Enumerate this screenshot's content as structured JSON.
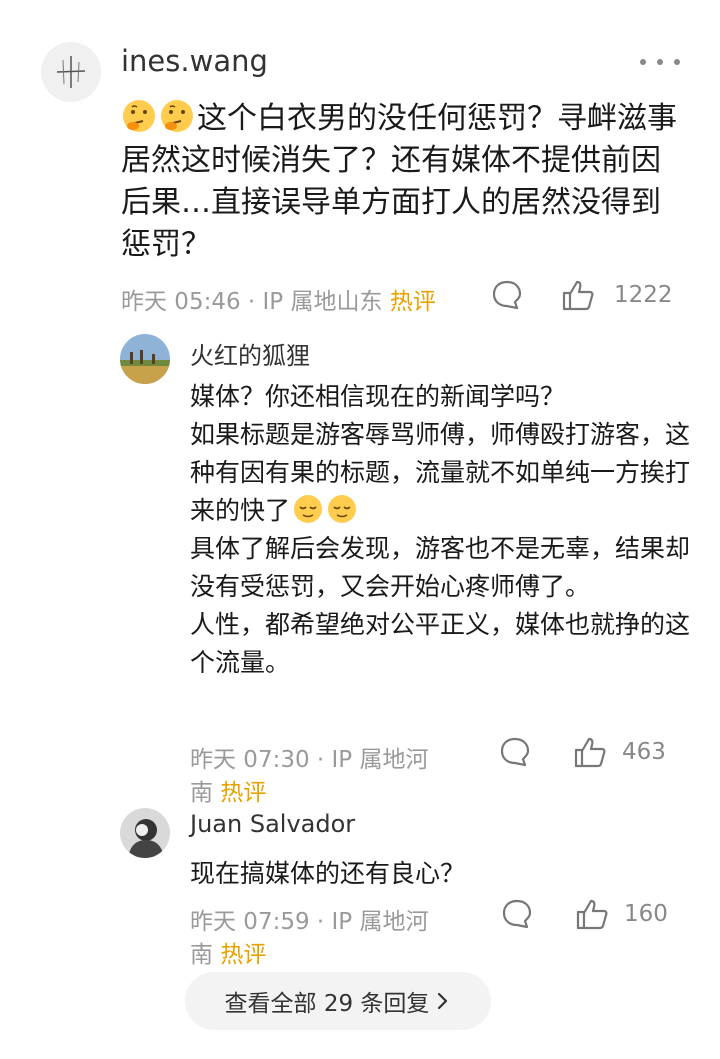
{
  "main_comment": {
    "username": "ines.wang",
    "avatar_icon": "cross-sketch-avatar",
    "body_lines": [
      "这个白衣男的没任何惩罚？寻衅滋事",
      "居然这时候消失了？还有媒体不提供前因",
      "后果…直接误导单方面打人的居然没得到",
      "惩罚？"
    ],
    "emojis": [
      "thinking-face",
      "thinking-face"
    ],
    "time": "昨天 05:46",
    "ip_label": "· IP 属地山东",
    "hot_label": "热评",
    "likes": "1222"
  },
  "replies": [
    {
      "username": "火红的狐狸",
      "avatar_icon": "landscape-avatar",
      "paragraphs": [
        "媒体？你还相信现在的新闻学吗？",
        "如果标题是游客辱骂师傅，师傅殴打游客，这种有因有果的标题，流量就不如单纯一方挨打来的快了",
        "具体了解后会发现，游客也不是无辜，结果却没有受惩罚，又会开始心疼师傅了。",
        "人性，都希望绝对公平正义，媒体也就挣的这个流量。"
      ],
      "emojis": [
        "relieved-face",
        "relieved-face"
      ],
      "meta_line1": "昨天 07:30 · IP 属地河",
      "meta_line2_prefix": "南",
      "hot_label": "热评",
      "likes": "463"
    },
    {
      "username": "Juan Salvador",
      "avatar_icon": "portrait-avatar",
      "paragraphs": [
        "现在搞媒体的还有良心？"
      ],
      "meta_line1": "昨天 07:59 · IP 属地河",
      "meta_line2_prefix": "南",
      "hot_label": "热评",
      "likes": "160"
    }
  ],
  "view_all": {
    "label": "查看全部 29 条回复",
    "chevron_icon": "chevron-right-icon"
  },
  "colors": {
    "hot": "#e9a100",
    "meta": "#9a9a9a",
    "text": "#1a1a1a"
  }
}
